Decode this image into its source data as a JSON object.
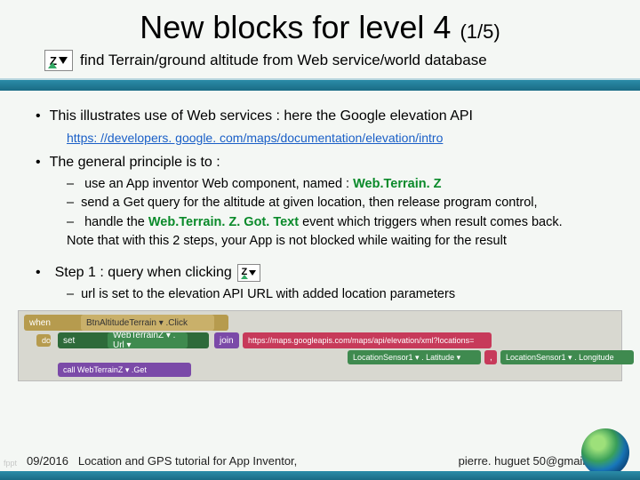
{
  "title_main": "New blocks for level 4 ",
  "title_pager": "(1/5)",
  "icon_z": "Z",
  "subtitle": "find Terrain/ground altitude from Web service/world database",
  "b1": "This illustrates use of Web services : here the Google elevation API",
  "link": "https: //developers. google. com/maps/documentation/elevation/intro",
  "b2": "The general principle is to :",
  "b2s1_pre": "use an App inventor Web component, named : ",
  "b2s1_green": "Web.Terrain. Z",
  "b2s2": "send a Get query for the altitude at given location, then release program control,",
  "b2s3_pre": "handle the ",
  "b2s3_green": "Web.Terrain. Z. Got. Text",
  "b2s3_post": " event which triggers when result comes back.",
  "note": "Note that with this 2 steps, your App is not blocked while waiting for the result",
  "b3": "Step 1 : query when clicking",
  "b3s1": "url is set to the elevation API URL with added location parameters",
  "blocks": {
    "when": "when",
    "click": "BtnAltitudeTerrain ▾ .Click",
    "do": "do",
    "set": "set",
    "seturl": "WebTerrainZ ▾ . Url ▾",
    "join": "join",
    "url": "https://maps.googleapis.com/maps/api/elevation/xml?locations=",
    "loc1": "LocationSensor1 ▾ . Latitude ▾",
    "comma": ",",
    "loc2": "LocationSensor1 ▾ . Longitude",
    "call": "call WebTerrainZ ▾ .Get"
  },
  "footer_date": "09/2016",
  "footer_left": "Location and GPS tutorial for App Inventor,",
  "footer_right": "pierre. huguet 50@gmail. com",
  "fppt": "fppt"
}
